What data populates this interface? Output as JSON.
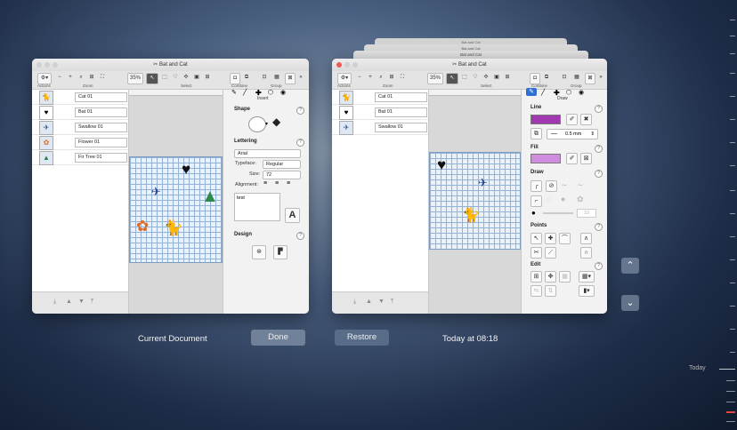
{
  "left_window": {
    "title": "Bat and Cat",
    "zoom": "35%",
    "toolbar_labels": [
      "Actions",
      "Zoom",
      "Select",
      "Combine",
      "Group"
    ],
    "layers": [
      "Cat 01",
      "Bat 01",
      "Swallow 01",
      "Flower 01",
      "Fir Tree 01"
    ],
    "panel_tab": "Insert",
    "shape_title": "Shape",
    "lettering_title": "Lettering",
    "font_value": "Arial",
    "typeface_label": "Typeface:",
    "typeface_value": "Regular",
    "size_label": "Size:",
    "size_value": "72",
    "alignment_label": "Alignment:",
    "text_value": "test",
    "design_title": "Design"
  },
  "right_window": {
    "title": "Bat and Cat",
    "stack_titles": [
      "Bat and Cat",
      "Bat and Cat",
      "Bat and Cat"
    ],
    "zoom": "35%",
    "toolbar_labels": [
      "Actions",
      "Zoom",
      "Select",
      "Combine",
      "Group"
    ],
    "layers": [
      "Cat 01",
      "Bat 01",
      "Swallow 01"
    ],
    "panel_tab": "Draw",
    "line_title": "Line",
    "line_width": "0.5 mm",
    "fill_title": "Fill",
    "draw_title": "Draw",
    "draw_value": "10",
    "points_title": "Points",
    "edit_title": "Edit",
    "line_color": "#a13ab0",
    "fill_color": "#d08ddf"
  },
  "captions": {
    "current": "Current Document",
    "done": "Done",
    "restore": "Restore",
    "timestamp": "Today at 08:18",
    "timeline_label": "Today"
  }
}
